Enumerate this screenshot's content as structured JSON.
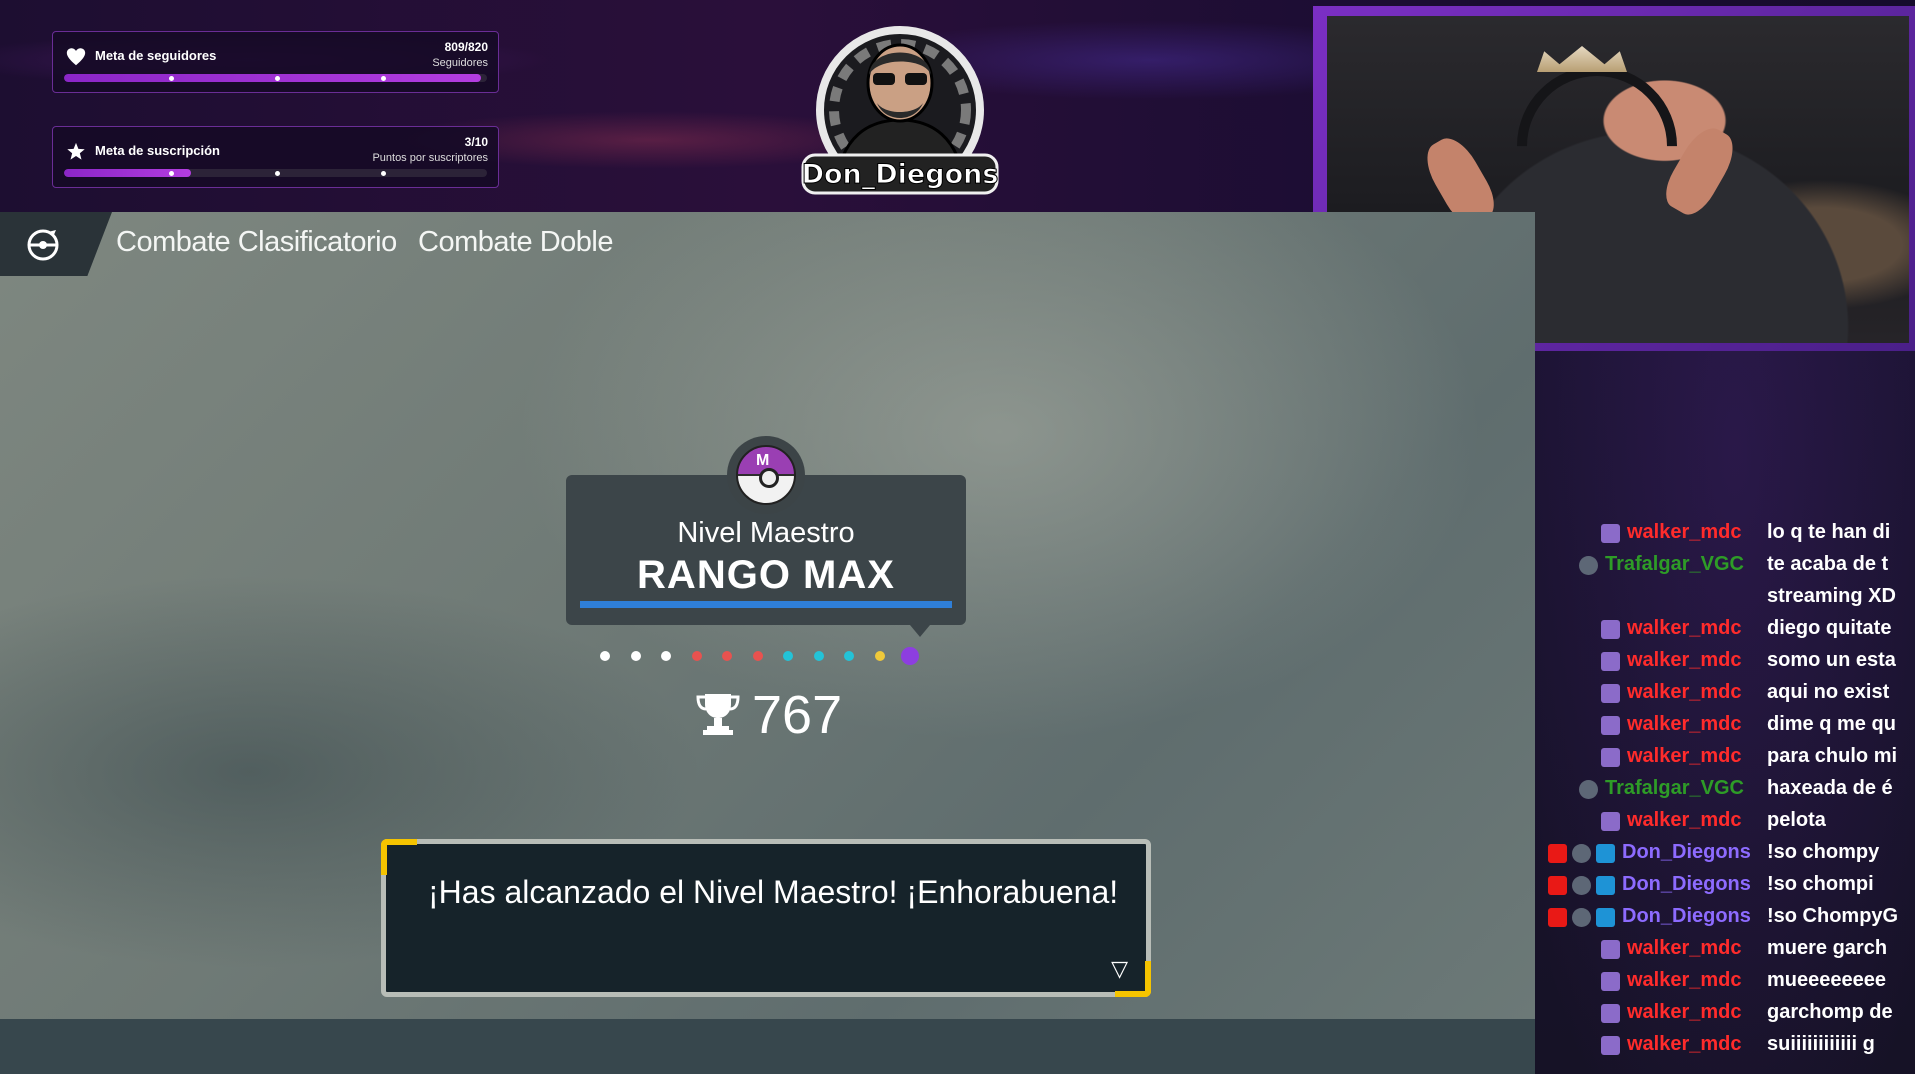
{
  "overlay": {
    "followers_goal": {
      "label": "Meta de seguidores",
      "count": "809/820",
      "unit": "Seguidores",
      "progress": 0.9866
    },
    "subs_goal": {
      "label": "Meta de suscripción",
      "count": "3/10",
      "unit": "Puntos por suscriptores",
      "progress": 0.3
    },
    "logo_text": "Don_Diegons"
  },
  "game": {
    "tabs": [
      "Combate Clasificatorio",
      "Combate Doble"
    ],
    "rank": {
      "level": "Nivel Maestro",
      "title": "RANGO MAX",
      "ball_letter": "M"
    },
    "progress_dot_colors": [
      "#ffffff",
      "#ffffff",
      "#ffffff",
      "#e8524f",
      "#e8524f",
      "#e8524f",
      "#23c3d8",
      "#23c3d8",
      "#23c3d8",
      "#f0c93a",
      "#8d3ee0"
    ],
    "score": "767",
    "dialog": "¡Has alcanzado el Nivel Maestro! ¡Enhorabuena!"
  },
  "colors": {
    "purple_accent": "#7b2fc4",
    "chat_red": "#ff2b2b",
    "chat_green": "#2e9c27",
    "chat_blue": "#8d6bff"
  },
  "chat": {
    "messages": [
      {
        "badges": [
          "sub"
        ],
        "user": "walker_mdc",
        "color": "#ff2b2b",
        "text": "lo q te han di"
      },
      {
        "badges": [
          "gear"
        ],
        "user": "Trafalgar_VGC",
        "color": "#2e9c27",
        "text": "te acaba de t",
        "continuation": "streaming XD"
      },
      {
        "badges": [
          "sub"
        ],
        "user": "walker_mdc",
        "color": "#ff2b2b",
        "text": "diego quitate"
      },
      {
        "badges": [
          "sub"
        ],
        "user": "walker_mdc",
        "color": "#ff2b2b",
        "text": "somo un esta"
      },
      {
        "badges": [
          "sub"
        ],
        "user": "walker_mdc",
        "color": "#ff2b2b",
        "text": "aqui no exist"
      },
      {
        "badges": [
          "sub"
        ],
        "user": "walker_mdc",
        "color": "#ff2b2b",
        "text": "dime q me qu"
      },
      {
        "badges": [
          "sub"
        ],
        "user": "walker_mdc",
        "color": "#ff2b2b",
        "text": "para chulo mi"
      },
      {
        "badges": [
          "gear"
        ],
        "user": "Trafalgar_VGC",
        "color": "#2e9c27",
        "text": "haxeada de é"
      },
      {
        "badges": [
          "sub"
        ],
        "user": "walker_mdc",
        "color": "#ff2b2b",
        "text": "pelota"
      },
      {
        "badges": [
          "broadcaster",
          "gear",
          "mod"
        ],
        "user": "Don_Diegons",
        "color": "#8d6bff",
        "text": "!so chompy"
      },
      {
        "badges": [
          "broadcaster",
          "gear",
          "mod"
        ],
        "user": "Don_Diegons",
        "color": "#8d6bff",
        "text": "!so chompi"
      },
      {
        "badges": [
          "broadcaster",
          "gear",
          "mod"
        ],
        "user": "Don_Diegons",
        "color": "#8d6bff",
        "text": "!so ChompyG"
      },
      {
        "badges": [
          "sub"
        ],
        "user": "walker_mdc",
        "color": "#ff2b2b",
        "text": "muere garch"
      },
      {
        "badges": [
          "sub"
        ],
        "user": "walker_mdc",
        "color": "#ff2b2b",
        "text": "mueeeeeeee"
      },
      {
        "badges": [
          "sub"
        ],
        "user": "walker_mdc",
        "color": "#ff2b2b",
        "text": "garchomp de"
      },
      {
        "badges": [
          "sub"
        ],
        "user": "walker_mdc",
        "color": "#ff2b2b",
        "text": "suiiiiiiiiiiii g"
      }
    ]
  }
}
